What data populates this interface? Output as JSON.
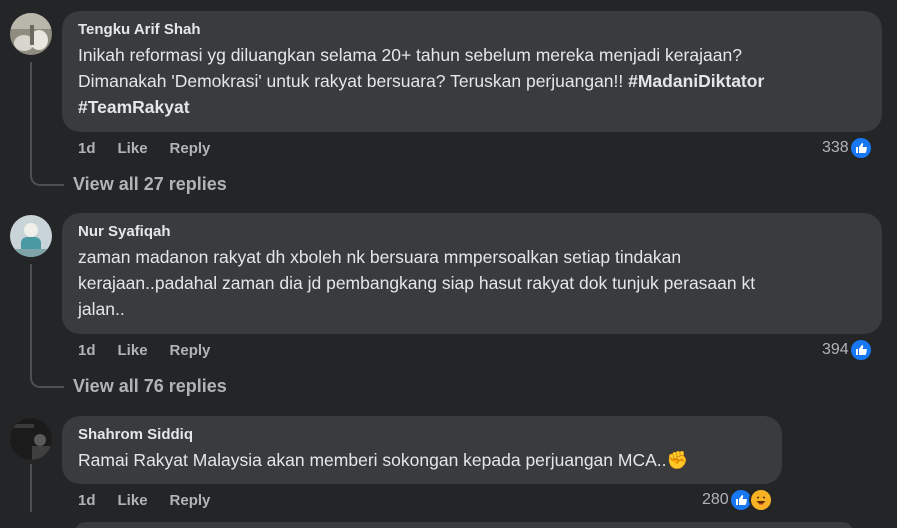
{
  "comments": [
    {
      "author": "Tengku Arif Shah",
      "text_lines": [
        "Inikah reformasi yg diluangkan selama 20+ tahun sebelum mereka menjadi kerajaan?",
        "Dimanakah 'Demokrasi' untuk rakyat bersuara? Teruskan perjuangan!! "
      ],
      "hashtag1": "#MadaniDiktator",
      "hashtag2": "#TeamRakyat",
      "age": "1d",
      "like_label": "Like",
      "reply_label": "Reply",
      "reaction_count": "338",
      "view_replies": "View all 27 replies"
    },
    {
      "author": "Nur Syafiqah",
      "text": "zaman madanon rakyat dh xboleh nk bersuara mmpersoalkan setiap tindakan\nkerajaan..padahal zaman dia jd pembangkang siap hasut rakyat dok tunjuk perasaan kt\njalan..",
      "age": "1d",
      "like_label": "Like",
      "reply_label": "Reply",
      "reaction_count": "394",
      "view_replies": "View all 76 replies"
    },
    {
      "author": "Shahrom Siddiq",
      "text": "Ramai Rakyat Malaysia akan memberi sokongan kepada perjuangan MCA..",
      "emoji": "✊",
      "age": "1d",
      "like_label": "Like",
      "reply_label": "Reply",
      "reaction_count": "280"
    }
  ],
  "icons": {
    "like": "like-reaction-icon",
    "haha": "haha-reaction-icon"
  },
  "colors": {
    "background": "#242526",
    "bubble": "#3a3b3c",
    "like_blue": "#1877f2",
    "muted_text": "#b0b3b8"
  }
}
